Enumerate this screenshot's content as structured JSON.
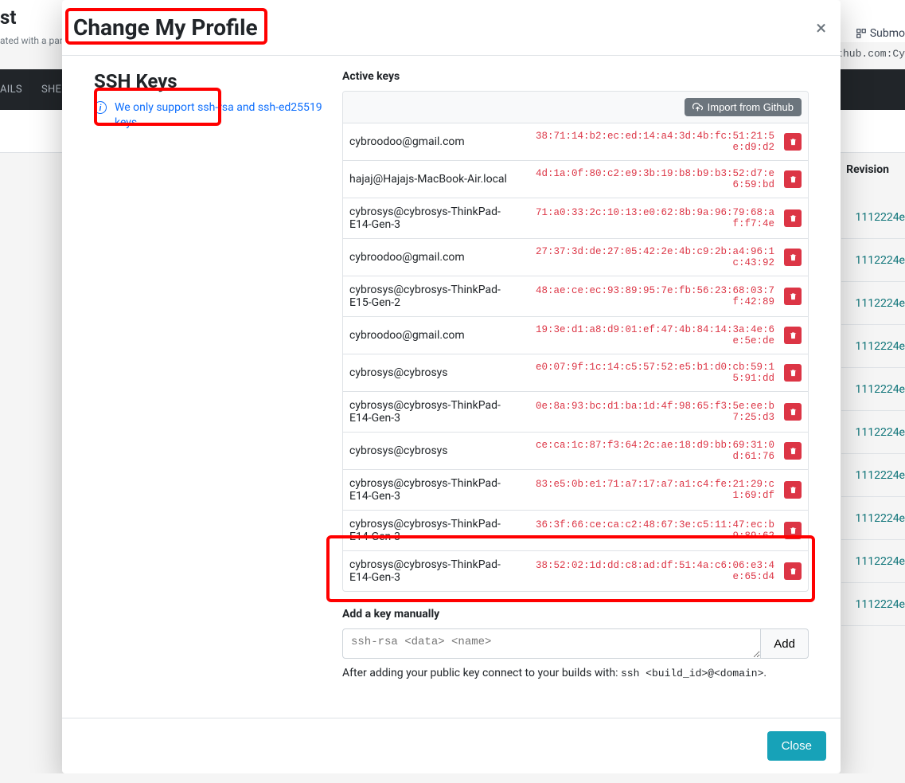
{
  "background": {
    "title_suffix": "st",
    "subtitle": "ated with a part",
    "submodules_label": "Submo",
    "clone_fragment": "@github.com:Cy",
    "navitem1": "AILS",
    "navitem2": "SHE",
    "revision_header": "Revision",
    "revision_value": "1112224e"
  },
  "modal": {
    "title": "Change My Profile",
    "ssh_heading": "SSH Keys",
    "info_text": "We only support ssh-rsa and ssh-ed25519 keys",
    "active_label": "Active keys",
    "import_label": "Import from Github",
    "keys": [
      {
        "email": "cybroodoo@gmail.com",
        "fp": "38:71:14:b2:ec:ed:14:a4:3d:4b:fc:51:21:5e:d9:d2"
      },
      {
        "email": "hajaj@Hajajs-MacBook-Air.local",
        "fp": "4d:1a:0f:80:c2:e9:3b:19:b8:b9:b3:52:d7:e6:59:bd"
      },
      {
        "email": "cybrosys@cybrosys-ThinkPad-E14-Gen-3",
        "fp": "71:a0:33:2c:10:13:e0:62:8b:9a:96:79:68:af:f7:4e"
      },
      {
        "email": "cybroodoo@gmail.com",
        "fp": "27:37:3d:de:27:05:42:2e:4b:c9:2b:a4:96:1c:43:92"
      },
      {
        "email": "cybrosys@cybrosys-ThinkPad-E15-Gen-2",
        "fp": "48:ae:ce:ec:93:89:95:7e:fb:56:23:68:03:7f:42:89"
      },
      {
        "email": "cybroodoo@gmail.com",
        "fp": "19:3e:d1:a8:d9:01:ef:47:4b:84:14:3a:4e:6e:5e:de"
      },
      {
        "email": "cybrosys@cybrosys",
        "fp": "e0:07:9f:1c:14:c5:57:52:e5:b1:d0:cb:59:15:91:dd"
      },
      {
        "email": "cybrosys@cybrosys-ThinkPad-E14-Gen-3",
        "fp": "0e:8a:93:bc:d1:ba:1d:4f:98:65:f3:5e:ee:b7:25:d3"
      },
      {
        "email": "cybrosys@cybrosys",
        "fp": "ce:ca:1c:87:f3:64:2c:ae:18:d9:bb:69:31:0d:61:76"
      },
      {
        "email": "cybrosys@cybrosys-ThinkPad-E14-Gen-3",
        "fp": "83:e5:0b:e1:71:a7:17:a7:a1:c4:fe:21:29:c1:69:df"
      },
      {
        "email": "cybrosys@cybrosys-ThinkPad-E14-Gen-3",
        "fp": "36:3f:66:ce:ca:c2:48:67:3e:c5:11:47:ec:b9:89:62"
      },
      {
        "email": "cybrosys@cybrosys-ThinkPad-E14-Gen-3",
        "fp": "38:52:02:1d:dd:c8:ad:df:51:4a:c6:06:e3:4e:65:d4"
      }
    ],
    "manual_label": "Add a key manually",
    "manual_placeholder": "ssh-rsa <data> <name>",
    "add_label": "Add",
    "after_prefix": "After adding your public key connect to your builds with: ",
    "after_code": "ssh <build_id>@<domain>",
    "after_suffix": ".",
    "close_label": "Close"
  }
}
